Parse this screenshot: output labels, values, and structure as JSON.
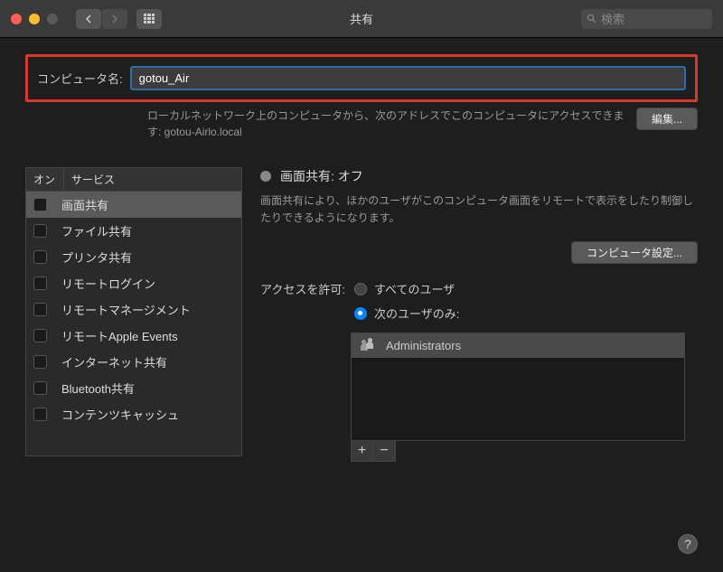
{
  "window": {
    "title": "共有",
    "search_placeholder": "検索"
  },
  "header": {
    "computer_name_label": "コンピュータ名:",
    "computer_name_value": "gotou_Air",
    "network_text": "ローカルネットワーク上のコンピュータから、次のアドレスでこのコンピュータにアクセスできます: gotou-Airlo.local",
    "edit_button": "編集..."
  },
  "services": {
    "col_on": "オン",
    "col_service": "サービス",
    "items": [
      "画面共有",
      "ファイル共有",
      "プリンタ共有",
      "リモートログイン",
      "リモートマネージメント",
      "リモートApple Events",
      "インターネット共有",
      "Bluetooth共有",
      "コンテンツキャッシュ"
    ],
    "selected_index": 0
  },
  "detail": {
    "status_title": "画面共有: オフ",
    "status_desc": "画面共有により、ほかのユーザがこのコンピュータ画面をリモートで表示をしたり制御したりできるようになります。",
    "computer_settings_button": "コンピュータ設定...",
    "access_label": "アクセスを許可:",
    "radio_all": "すべてのユーザ",
    "radio_only": "次のユーザのみ:",
    "users": [
      "Administrators"
    ],
    "add_label": "+",
    "remove_label": "−"
  },
  "help_label": "?"
}
